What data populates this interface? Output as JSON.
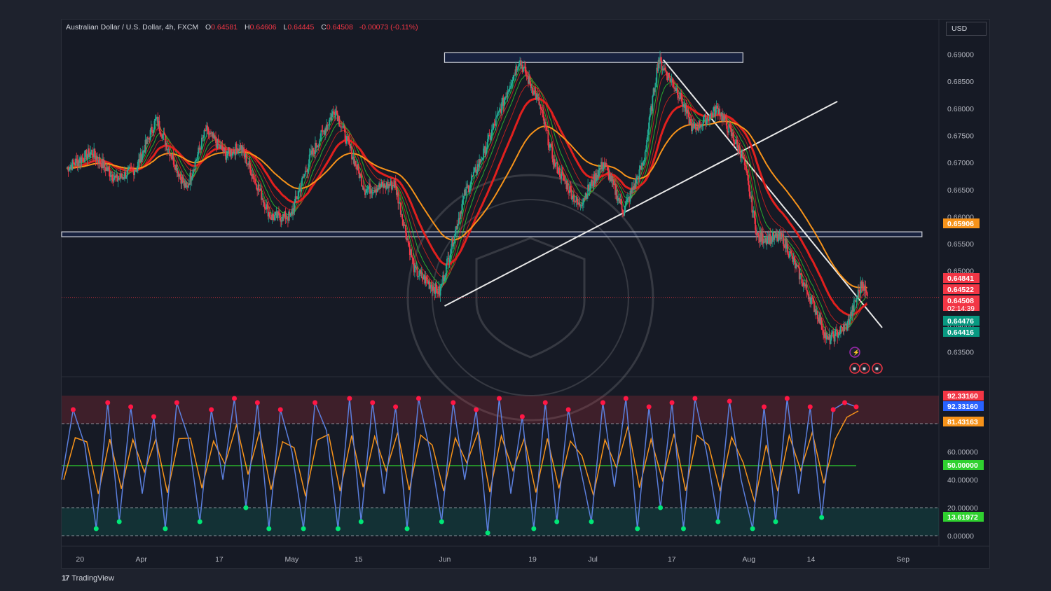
{
  "legend": {
    "symbol": "Australian Dollar / U.S. Dollar, 4h, FXCM",
    "o_label": "O",
    "o_value": "0.64581",
    "h_label": "H",
    "h_value": "0.64606",
    "l_label": "L",
    "l_value": "0.64445",
    "c_label": "C",
    "c_value": "0.64508",
    "change": "-0.00073 (-0.11%)"
  },
  "currency_button": "USD",
  "branding": "TradingView",
  "colors": {
    "background": "#161a25",
    "bull": "#22ab94",
    "bear": "#f23645",
    "ema_green": "#2fd12f",
    "ema_red": "#e0201e",
    "sma_orange": "#f7931a",
    "stoch_k": "#5b7fdd",
    "stoch_d": "#f7931a"
  },
  "chart_data": [
    {
      "type": "candlestick",
      "title": "Australian Dollar / U.S. Dollar, 4h, FXCM",
      "ylim": [
        0.6325,
        0.6915
      ],
      "y_ticks": [
        "0.69000",
        "0.68500",
        "0.68000",
        "0.67500",
        "0.67000",
        "0.66500",
        "0.66000",
        "0.65500",
        "0.65000",
        "0.64500",
        "0.64000",
        "0.63500"
      ],
      "x_ticks": [
        {
          "label": "20",
          "date": "2023-03-20"
        },
        {
          "label": "Apr",
          "date": "2023-04-01"
        },
        {
          "label": "17",
          "date": "2023-04-17"
        },
        {
          "label": "May",
          "date": "2023-05-01"
        },
        {
          "label": "15",
          "date": "2023-05-15"
        },
        {
          "label": "Jun",
          "date": "2023-06-01"
        },
        {
          "label": "19",
          "date": "2023-06-19"
        },
        {
          "label": "Jul",
          "date": "2023-07-01"
        },
        {
          "label": "17",
          "date": "2023-07-17"
        },
        {
          "label": "Aug",
          "date": "2023-08-01"
        },
        {
          "label": "14",
          "date": "2023-08-14"
        },
        {
          "label": "Sep",
          "date": "2023-09-01"
        }
      ],
      "series": [
        {
          "name": "AUDUSD close",
          "points": [
            [
              "2023-03-17",
              0.669
            ],
            [
              "2023-03-22",
              0.672
            ],
            [
              "2023-03-27",
              0.6668
            ],
            [
              "2023-03-31",
              0.669
            ],
            [
              "2023-04-04",
              0.678
            ],
            [
              "2023-04-10",
              0.665
            ],
            [
              "2023-04-14",
              0.676
            ],
            [
              "2023-04-18",
              0.6715
            ],
            [
              "2023-04-21",
              0.673
            ],
            [
              "2023-04-27",
              0.66
            ],
            [
              "2023-05-01",
              0.66
            ],
            [
              "2023-05-05",
              0.671
            ],
            [
              "2023-05-10",
              0.68
            ],
            [
              "2023-05-16",
              0.665
            ],
            [
              "2023-05-22",
              0.666
            ],
            [
              "2023-05-26",
              0.65
            ],
            [
              "2023-05-31",
              0.646
            ],
            [
              "2023-06-05",
              0.664
            ],
            [
              "2023-06-09",
              0.672
            ],
            [
              "2023-06-16",
              0.689
            ],
            [
              "2023-06-20",
              0.681
            ],
            [
              "2023-06-23",
              0.67
            ],
            [
              "2023-06-28",
              0.662
            ],
            [
              "2023-07-03",
              0.67
            ],
            [
              "2023-07-07",
              0.661
            ],
            [
              "2023-07-11",
              0.67
            ],
            [
              "2023-07-14",
              0.689
            ],
            [
              "2023-07-18",
              0.683
            ],
            [
              "2023-07-21",
              0.676
            ],
            [
              "2023-07-26",
              0.68
            ],
            [
              "2023-07-31",
              0.671
            ],
            [
              "2023-08-03",
              0.656
            ],
            [
              "2023-08-08",
              0.656
            ],
            [
              "2023-08-11",
              0.65
            ],
            [
              "2023-08-15",
              0.642
            ],
            [
              "2023-08-17",
              0.637
            ],
            [
              "2023-08-21",
              0.64
            ],
            [
              "2023-08-24",
              0.648
            ],
            [
              "2023-08-25",
              0.6451
            ]
          ]
        }
      ],
      "last_price": 0.64508,
      "countdown": "02:14:39",
      "price_labels": [
        {
          "value": "0.65906",
          "color": "#f7931a"
        },
        {
          "value": "0.64841",
          "color": "#f23645"
        },
        {
          "value": "0.64522",
          "color": "#f23645"
        },
        {
          "value": "0.64508",
          "color": "#f23645"
        },
        {
          "value": "0.64476",
          "color": "#089981"
        },
        {
          "value": "0.64416",
          "color": "#089981"
        }
      ],
      "drawings": {
        "resistance_zone": {
          "from": "2023-06-01",
          "to": "2023-07-31",
          "low": 0.6885,
          "high": 0.6903
        },
        "support_zone": {
          "from": "2023-03-16",
          "to": "2023-09-05",
          "low": 0.6563,
          "high": 0.6572
        },
        "uptrend_line": {
          "from": [
            "2023-06-01",
            0.6435
          ],
          "to": [
            "2023-08-19",
            0.6813
          ]
        },
        "downtrend_line": {
          "from": [
            "2023-07-15",
            0.689
          ],
          "to": [
            "2023-08-28",
            0.6395
          ]
        }
      },
      "event_icons": [
        "lightning",
        "us-flag",
        "us-flag",
        "us-flag"
      ]
    },
    {
      "type": "line",
      "title": "Stochastic RSI",
      "ylim": [
        0,
        100
      ],
      "y_ticks": [
        "0.00000",
        "20.00000",
        "40.00000",
        "60.00000",
        "80.00000"
      ],
      "bands": {
        "upper": 80,
        "middle": 50,
        "lower": 20
      },
      "value_labels": [
        {
          "value": "92.33160",
          "color": "#f23645"
        },
        {
          "value": "92.33160",
          "color": "#2962ff"
        },
        {
          "value": "81.43163",
          "color": "#f7931a"
        },
        {
          "value": "50.00000",
          "color": "#2fd12f"
        },
        {
          "value": "13.61972",
          "color": "#2fd12f"
        }
      ],
      "series": [
        {
          "name": "%K",
          "values": [
            40,
            90,
            65,
            5,
            95,
            10,
            92,
            30,
            85,
            5,
            95,
            70,
            10,
            90,
            40,
            98,
            20,
            95,
            5,
            90,
            60,
            5,
            95,
            75,
            5,
            98,
            10,
            95,
            30,
            92,
            5,
            98,
            60,
            10,
            95,
            40,
            90,
            2,
            98,
            30,
            85,
            5,
            95,
            10,
            90,
            50,
            10,
            95,
            35,
            98,
            5,
            92,
            20,
            95,
            5,
            98,
            60,
            10,
            96,
            40,
            5,
            92,
            10,
            98,
            30,
            92,
            13,
            90,
            95,
            92
          ]
        }
      ]
    }
  ]
}
